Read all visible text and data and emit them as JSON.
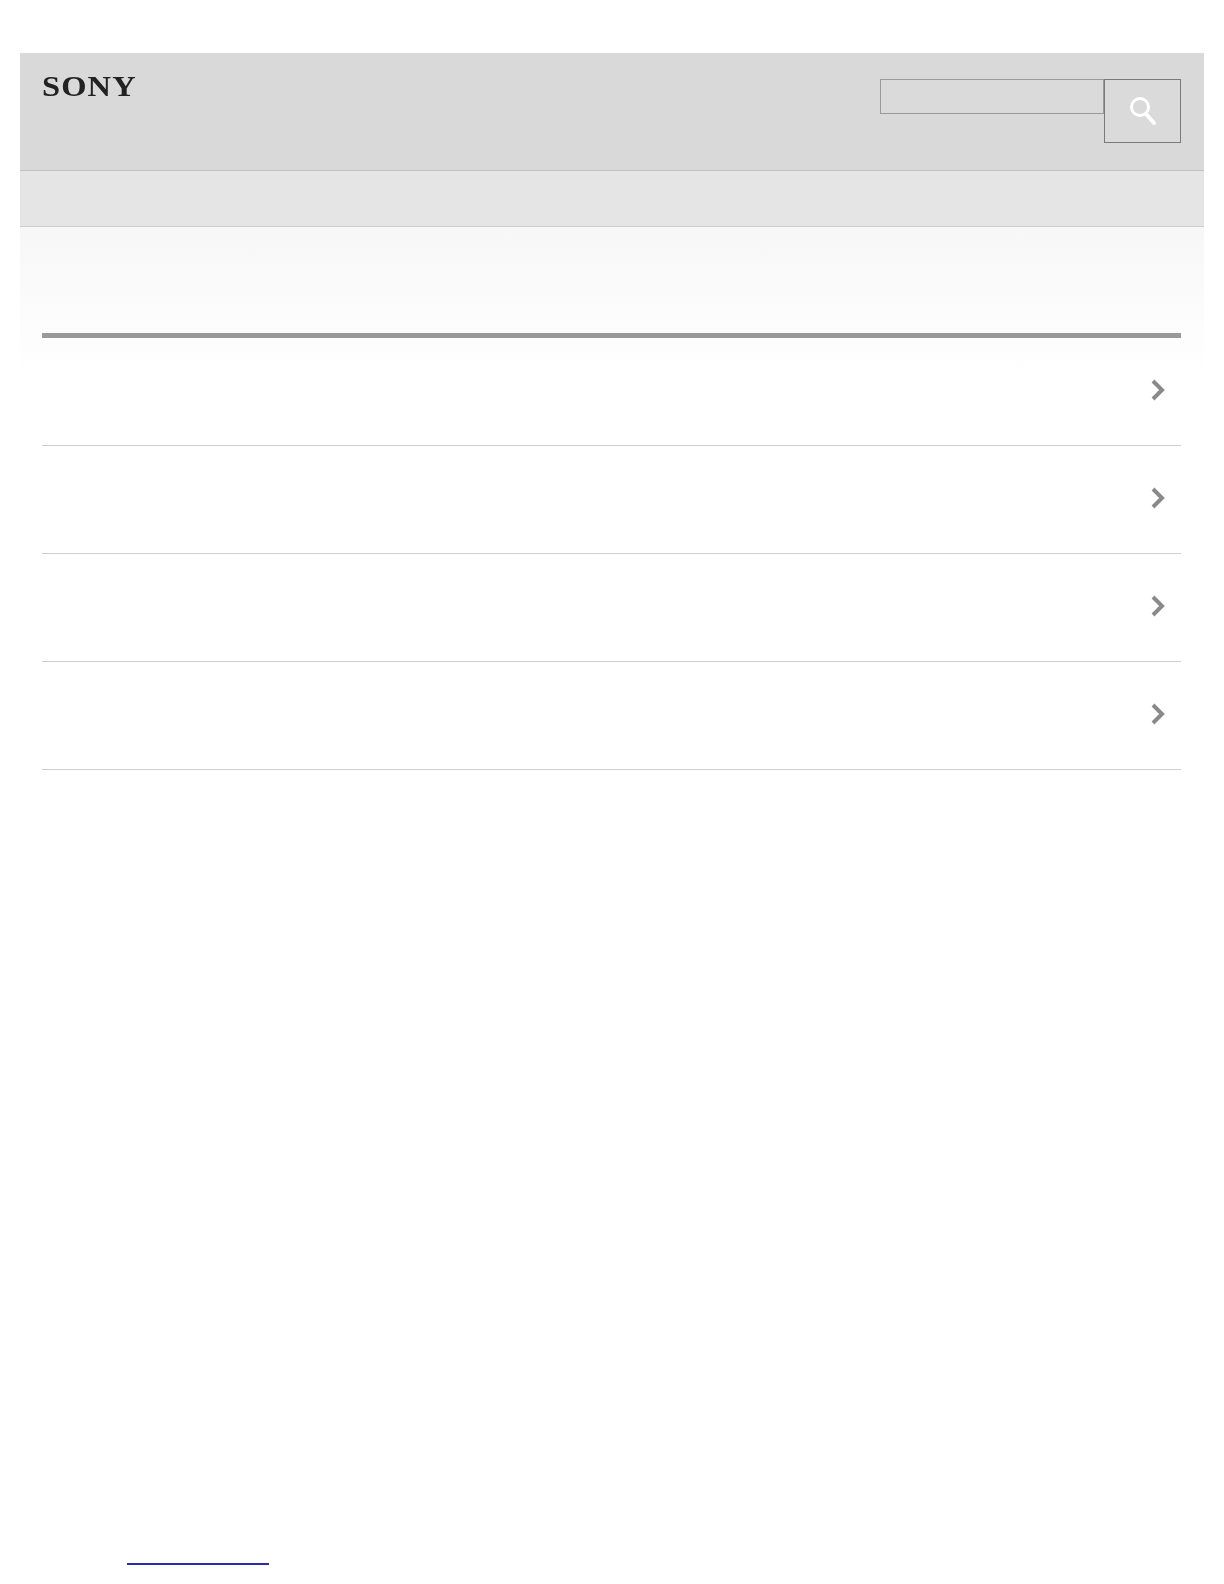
{
  "header": {
    "logo": "SONY"
  },
  "list": {
    "rows": [
      {
        "kind": "link"
      },
      {
        "kind": "link"
      },
      {
        "kind": "link"
      },
      {
        "kind": "link"
      }
    ]
  }
}
